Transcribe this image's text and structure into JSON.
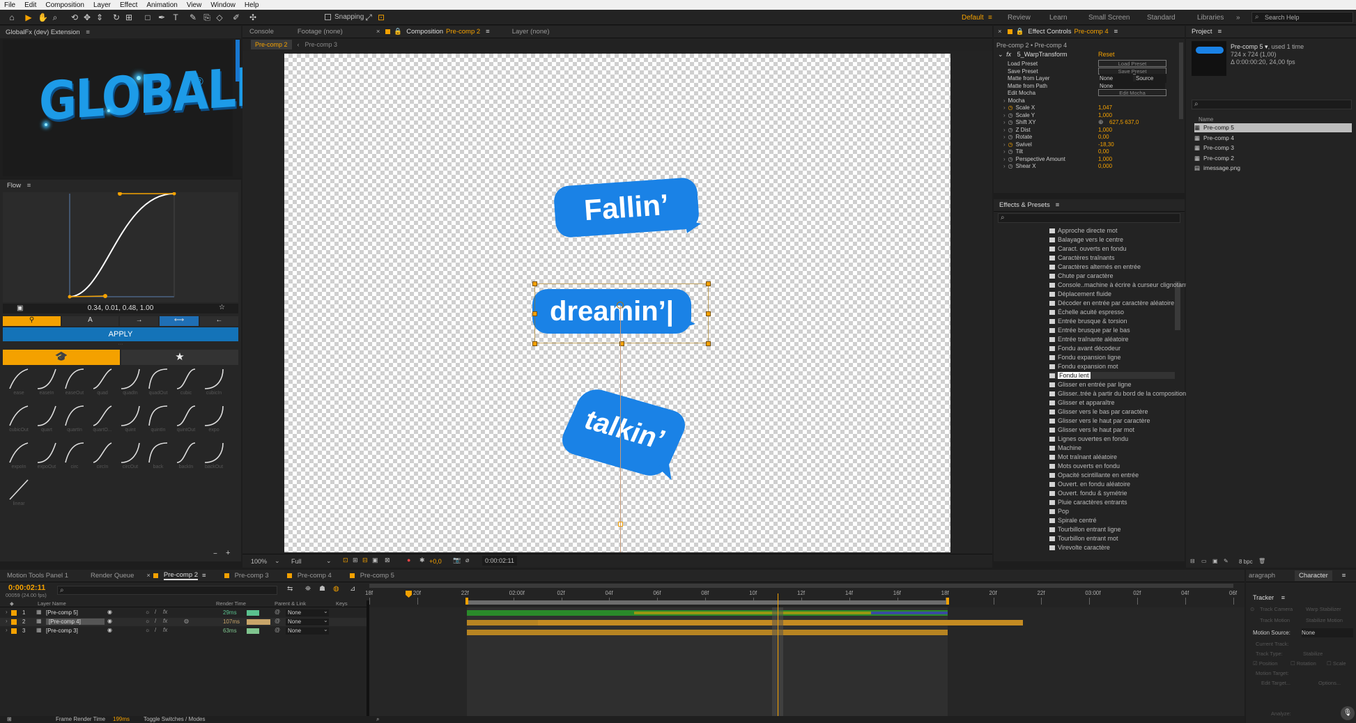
{
  "menu": [
    "File",
    "Edit",
    "Composition",
    "Layer",
    "Effect",
    "Animation",
    "View",
    "Window",
    "Help"
  ],
  "toolbar": {
    "snapping": "Snapping"
  },
  "workspaces": {
    "default": "Default",
    "items": [
      "Review",
      "Learn",
      "Small Screen",
      "Standard",
      "Libraries"
    ],
    "search": "Search Help"
  },
  "extension": {
    "title": "GlobalFx (dev) Extension",
    "logo": "GLOBALFX",
    "reg": "®"
  },
  "flow": {
    "title": "Flow",
    "bezier": "0.34, 0.01, 0.48, 1.00",
    "apply": "APPLY",
    "eases": [
      "ease",
      "easeIn",
      "easeOut",
      "quad",
      "quadIn",
      "quadOut",
      "cubic",
      "cubicIn",
      "cubicOut",
      "quart",
      "quartIn",
      "quartO...",
      "quint",
      "quintIn",
      "quintOut",
      "expo",
      "expoIn",
      "expoOut",
      "circ",
      "circIn",
      "circOut",
      "back",
      "backIn",
      "backOut",
      "linear"
    ]
  },
  "comp": {
    "tabs": [
      "Console",
      "Footage (none)",
      "Composition",
      "Pre-comp 2",
      "Layer (none)"
    ],
    "subtabs": [
      "Pre-comp 2",
      "Pre-comp 3"
    ],
    "zoom": "100%",
    "quality": "Full",
    "exposure": "+0,0",
    "timecode": "0:00:02:11",
    "bubbles": [
      "Fallin’",
      "dreamin’|",
      "talkin’"
    ]
  },
  "effectControls": {
    "tab": "Effect Controls",
    "layer": "Pre-comp 4",
    "path": "Pre-comp 2 • Pre-comp 4",
    "effect": "5_WarpTransform",
    "reset": "Reset",
    "rows": [
      {
        "label": "Load Preset",
        "btn": "Load Preset"
      },
      {
        "label": "Save Preset",
        "btn": "Save Preset"
      },
      {
        "label": "Matte from Layer",
        "v1": "None",
        "v2": "Source"
      },
      {
        "label": "Matte from Path",
        "v1": "None"
      },
      {
        "label": "Edit Mocha",
        "btn": "Edit Mocha"
      },
      {
        "label": "Mocha"
      },
      {
        "label": "Scale X",
        "value": "1,047"
      },
      {
        "label": "Scale Y",
        "value": "1,000"
      },
      {
        "label": "Shift XY",
        "value": "627,5 637,0"
      },
      {
        "label": "Z Dist",
        "value": "1,000"
      },
      {
        "label": "Rotate",
        "value": "0,00"
      },
      {
        "label": "Swivel",
        "value": "-18,30"
      },
      {
        "label": "Tilt",
        "value": "0,00"
      },
      {
        "label": "Perspective Amount",
        "value": "1,000"
      },
      {
        "label": "Shear X",
        "value": "0,000"
      }
    ]
  },
  "presets": {
    "title": "Effects & Presets",
    "items": [
      "Approche directe mot",
      "Balayage vers le centre",
      "Caract. ouverts en fondu",
      "Caractères traînants",
      "Caractères alternés en entrée",
      "Chute par caractère",
      "Console..machine à écrire à curseur clignotant",
      "Déplacement fluide",
      "Décoder en entrée par caractère aléatoire",
      "Échelle acuité espresso",
      "Entrée brusque & torsion",
      "Entrée brusque par le bas",
      "Entrée traînante aléatoire",
      "Fondu avant décodeur",
      "Fondu expansion ligne",
      "Fondu expansion mot",
      "Fondu lent",
      "Glisser en entrée par ligne",
      "Glisser..trée à partir du bord de la composition",
      "Glisser et apparaître",
      "Glisser vers le bas par caractère",
      "Glisser vers le haut par caractère",
      "Glisser vers le haut par mot",
      "Lignes ouvertes en fondu",
      "Machine",
      "Mot traînant aléatoire",
      "Mots ouverts en fondu",
      "Opacité scintillante en entrée",
      "Ouvert. en fondu aléatoire",
      "Ouvert. fondu & symétrie",
      "Pluie caractères entrants",
      "Pop",
      "Spirale centré",
      "Tourbillon entrant ligne",
      "Tourbillon entrant mot",
      "Virevolte caractère"
    ],
    "selected": "Fondu lent"
  },
  "project": {
    "title": "Project",
    "name": "Pre-comp 5",
    "used": ", used 1 time",
    "size": "724 x 724 (1,00)",
    "duration": "Δ 0:00:00:20, 24,00 fps",
    "col": "Name",
    "items": [
      "Pre-comp 5",
      "Pre-comp 4",
      "Pre-comp 3",
      "Pre-comp 2",
      "imessage.png"
    ],
    "bpc": "8 bpc"
  },
  "timeline": {
    "tabs": [
      "Motion Tools Panel 1",
      "Render Queue",
      "Pre-comp 2",
      "Pre-comp 3",
      "Pre-comp 4",
      "Pre-comp 5"
    ],
    "time": "0:00:02:11",
    "frames": "00059 (24.00 fps)",
    "cols": {
      "name": "Layer Name",
      "render": "Render Time",
      "parent": "Parent & Link",
      "keys": "Keys"
    },
    "layers": [
      {
        "num": "1",
        "name": "[Pre-comp 5]",
        "ms": "29ms",
        "parent": "None"
      },
      {
        "num": "2",
        "name": "[Pre-comp 4]",
        "ms": "107ms",
        "parent": "None"
      },
      {
        "num": "3",
        "name": "[Pre-comp 3]",
        "ms": "63ms",
        "parent": "None"
      }
    ],
    "ruler": [
      "18f",
      "20f",
      "22f",
      "02:00f",
      "02f",
      "04f",
      "06f",
      "08f",
      "10f",
      "12f",
      "14f",
      "16f",
      "18f",
      "20f",
      "22f",
      "03:00f",
      "02f",
      "04f",
      "06f"
    ],
    "footer": {
      "label": "Frame Render Time",
      "value": "199ms",
      "toggle": "Toggle Switches / Modes"
    }
  },
  "tracker": {
    "tabs": [
      "aragraph",
      "Character"
    ],
    "title": "Tracker",
    "motionSource": "Motion Source:",
    "source": "None",
    "currentTrack": "Current Track:",
    "trackType": "Track Type:",
    "stabilize": "Stabilize",
    "position": "Position",
    "rotation": "Rotation",
    "scale": "Scale",
    "motionTarget": "Motion Target:",
    "editTarget": "Edit Target...",
    "options": "Options...",
    "analyze": "Analyze:",
    "btns": [
      "Track Camera",
      "Warp Stabilizer",
      "Track Motion",
      "Stabilize Motion"
    ]
  }
}
